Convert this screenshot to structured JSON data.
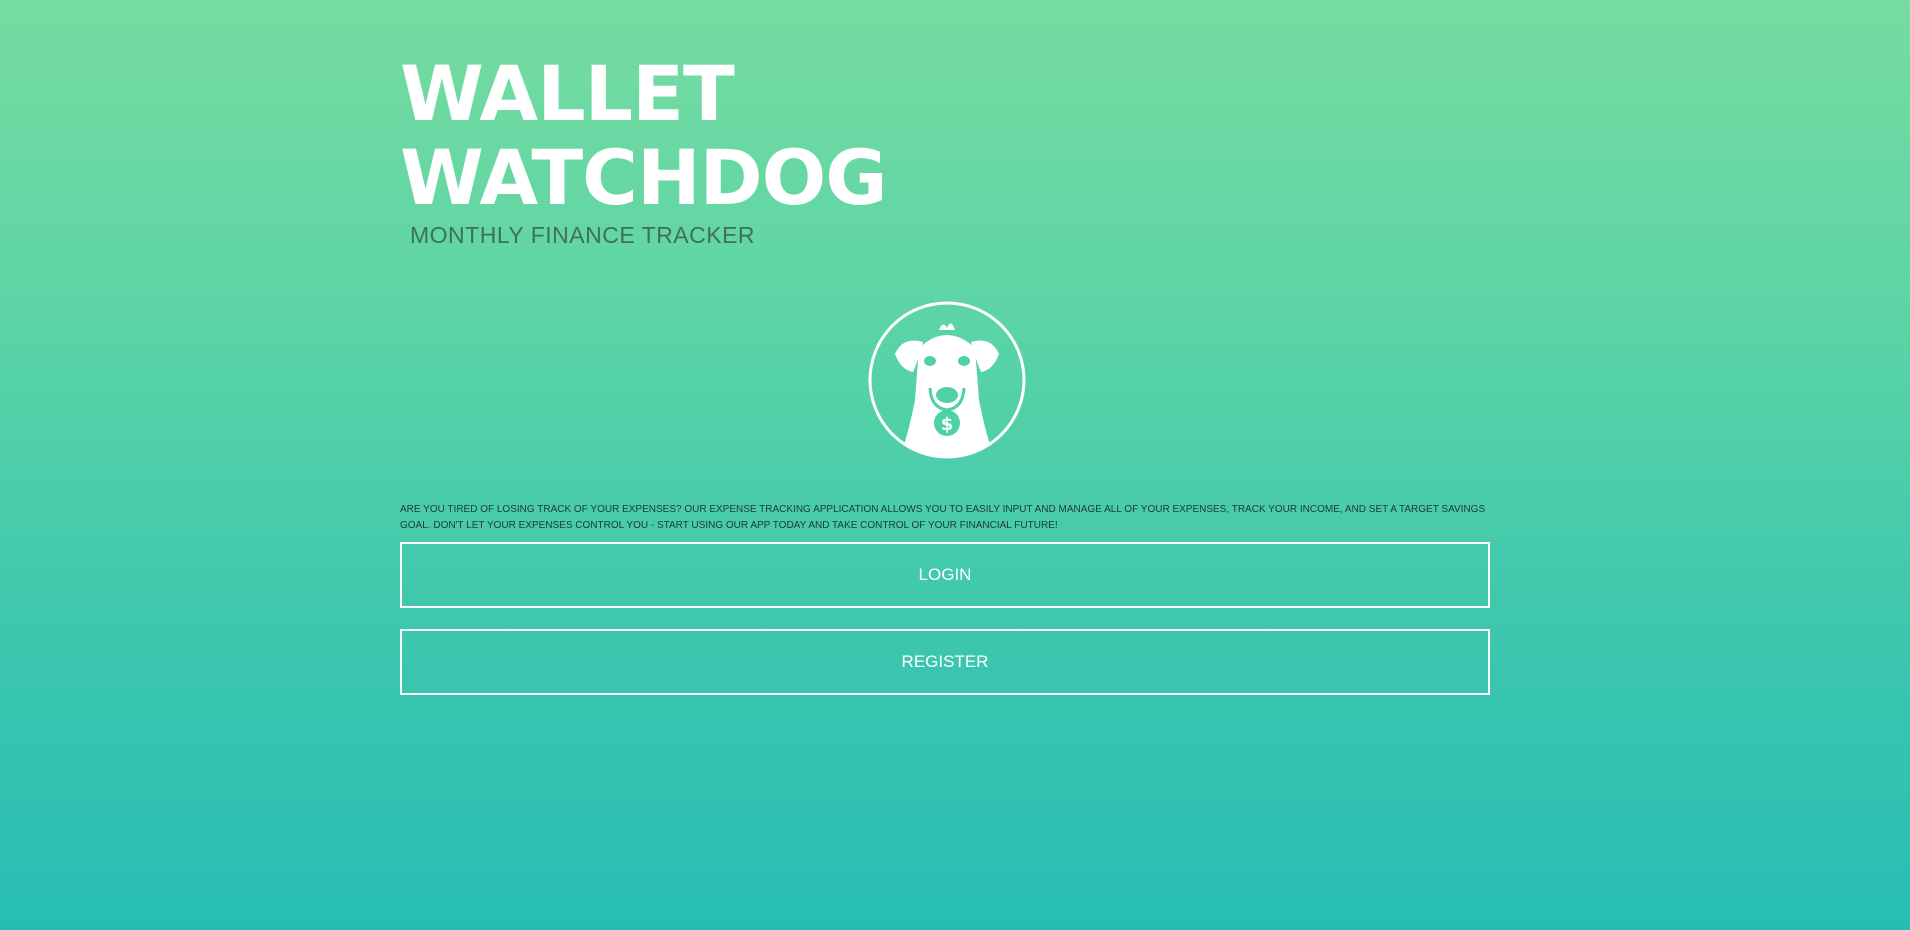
{
  "app": {
    "title": "WALLET\nWATCHDOG",
    "subtitle": "MONTHLY FINANCE TRACKER"
  },
  "logo": {
    "icon": "watchdog-dollar-tag-icon"
  },
  "intro": {
    "description": "ARE YOU TIRED OF LOSING TRACK OF YOUR EXPENSES? OUR EXPENSE TRACKING APPLICATION ALLOWS YOU TO EASILY INPUT AND MANAGE ALL OF YOUR EXPENSES, TRACK YOUR INCOME, AND SET A TARGET SAVINGS GOAL. DON'T LET YOUR EXPENSES CONTROL YOU - START USING OUR APP TODAY AND TAKE CONTROL OF YOUR FINANCIAL FUTURE!"
  },
  "actions": {
    "login_label": "LOGIN",
    "register_label": "REGISTER"
  },
  "colors": {
    "gradient_top": "#76dca0",
    "gradient_bottom": "#27bdb4",
    "subtitle_text": "#3f6f5e",
    "button_border": "#ffffff"
  }
}
